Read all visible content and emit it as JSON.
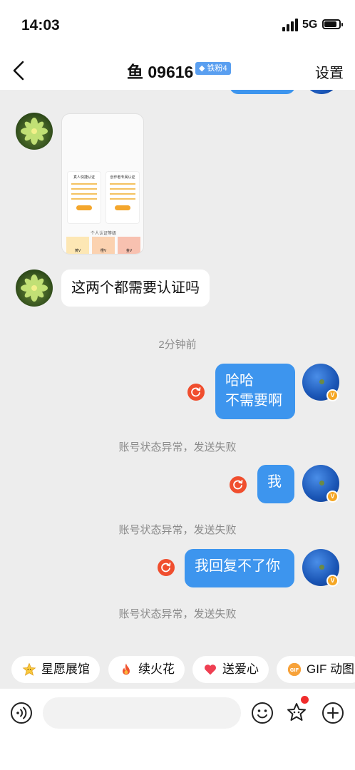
{
  "status_bar": {
    "time": "14:03",
    "network": "5G"
  },
  "header": {
    "back_icon": "chevron-left-icon",
    "title": "鱼 09616",
    "fan_badge": "铁粉4",
    "settings_label": "设置"
  },
  "messages": {
    "image_card": {
      "card1_title": "真人快捷认证",
      "card2_title": "创作者专属认证",
      "section_title": "个人认证等级",
      "level_labels": [
        "黄V",
        "橙V",
        "金V"
      ]
    },
    "text1": "这两个都需要认证吗",
    "time_divider": "2分钟前",
    "out1": {
      "line1": "哈哈",
      "line2": "不需要啊"
    },
    "fail1": "账号状态异常，发送失败",
    "out2": "我",
    "fail2": "账号状态异常，发送失败",
    "out3": "我回复不了你",
    "fail3": "账号状态异常，发送失败"
  },
  "quick_actions": [
    {
      "label": "星愿展馆",
      "icon": "star-face-icon"
    },
    {
      "label": "续火花",
      "icon": "flame-icon"
    },
    {
      "label": "送爱心",
      "icon": "heart-icon"
    },
    {
      "label": "GIF 动图",
      "icon": "gif-icon"
    }
  ],
  "input_bar": {
    "placeholder": ""
  },
  "colors": {
    "accent": "#3d95ee",
    "error": "#f04e2e",
    "background": "#ededed"
  }
}
